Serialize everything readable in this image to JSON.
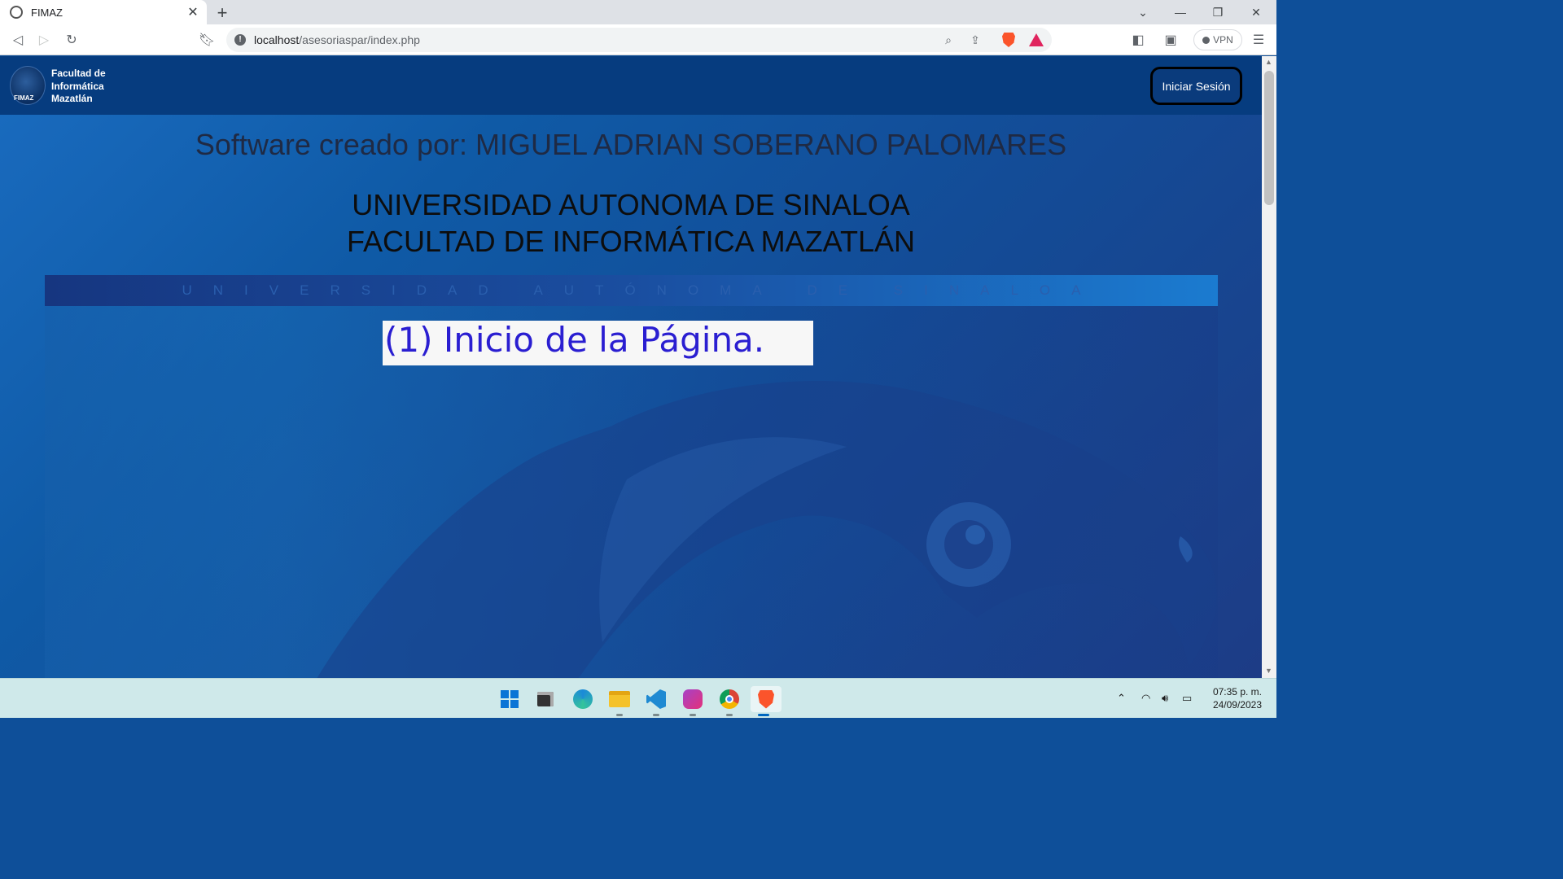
{
  "browser": {
    "tab_title": "FIMAZ",
    "url_host": "localhost",
    "url_path": "/asesoriaspar/index.php",
    "vpn_label": "VPN"
  },
  "nav": {
    "logo_text": "FIMAZ",
    "brand_line1": "Facultad de",
    "brand_line2": "Informática",
    "brand_line3": "Mazatlán",
    "login_label": "Iniciar Sesión"
  },
  "hero": {
    "author": "Software creado por: MIGUEL ADRIAN SOBERANO PALOMARES",
    "university": "UNIVERSIDAD AUTONOMA DE SINALOA",
    "faculty": "FACULTAD DE INFORMÁTICA MAZATLÁN",
    "ribbon_text": "UNIVERSIDAD AUTÓNOMA DE SINALOA",
    "annotation": "(1) Inicio de la Página."
  },
  "taskbar": {
    "time": "07:35 p. m.",
    "date": "24/09/2023"
  },
  "colors": {
    "page_bg": "#0e4f99",
    "navbar": "#063c7f",
    "annotation_text": "#2a1ed1"
  }
}
